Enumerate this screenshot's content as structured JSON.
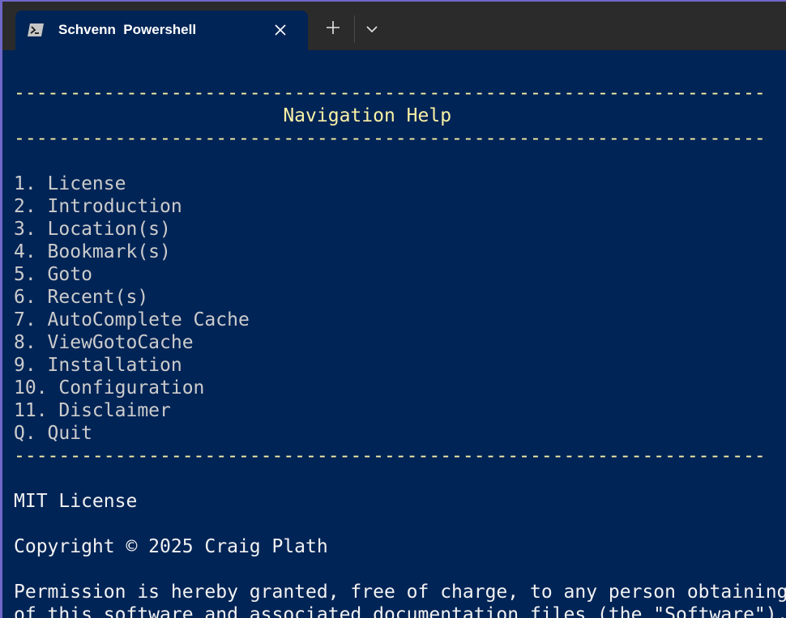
{
  "tab": {
    "title": "Schvenn  Powershell",
    "icon": "powershell-icon"
  },
  "terminal": {
    "rule": "-------------------------------------------------------------------",
    "heading": "                        Navigation Help",
    "menu": [
      "1. License",
      "2. Introduction",
      "3. Location(s)",
      "4. Bookmark(s)",
      "5. Goto",
      "6. Recent(s)",
      "7. AutoComplete Cache",
      "8. ViewGotoCache",
      "9. Installation",
      "10. Configuration",
      "11. Disclaimer",
      "Q. Quit"
    ],
    "license_title": "MIT License",
    "copyright": "Copyright © 2025 Craig Plath",
    "permission_1": "Permission is hereby granted, free of charge, to any person obtaining a copy",
    "permission_2": "of this software and associated documentation files (the \"Software\"), to deal"
  },
  "colors": {
    "background": "#012456",
    "titlebar": "#2b2b2b",
    "heading": "#f9f1a5",
    "text": "#cccccc"
  }
}
